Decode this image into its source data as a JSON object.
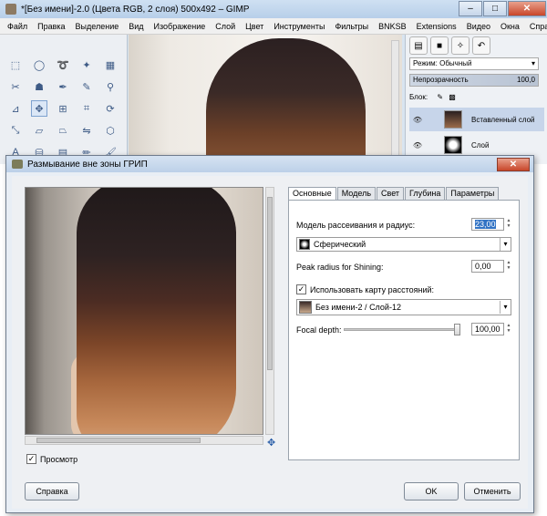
{
  "gimp": {
    "title": "*[Без имени]-2.0 (Цвета RGB, 2 слоя) 500x492 – GIMP",
    "menu": [
      "Файл",
      "Правка",
      "Выделение",
      "Вид",
      "Изображение",
      "Слой",
      "Цвет",
      "Инструменты",
      "Фильтры",
      "BNKSB",
      "Extensions",
      "Видео",
      "Окна",
      "Справка"
    ],
    "dock": {
      "mode_label": "Режим: Обычный",
      "opacity_label": "Непрозрачность",
      "opacity_value": "100,0",
      "lock_label": "Блок:",
      "layers": [
        "Вставленный слой",
        "Слой"
      ]
    }
  },
  "dialog": {
    "title": "Размывание вне зоны ГРИП",
    "tabs": [
      "Основные",
      "Модель",
      "Свет",
      "Глубина",
      "Параметры"
    ],
    "active_tab": "Основные",
    "blur_model_label": "Модель рассеивания и радиус:",
    "blur_radius": "23,00",
    "blur_model": "Сферический",
    "shining_label": "Peak radius for Shining:",
    "shining_value": "0,00",
    "use_depth_map_label": "Использовать карту расстояний:",
    "use_depth_map_checked": true,
    "depth_map": "Без имени-2 / Слой-12",
    "focal_label": "Focal depth:",
    "focal_value": "100,00",
    "focal_fraction": 1.0,
    "preview_label": "Просмотр",
    "preview_checked": true,
    "help_button": "Справка",
    "ok_button": "OK",
    "cancel_button": "Отменить"
  }
}
